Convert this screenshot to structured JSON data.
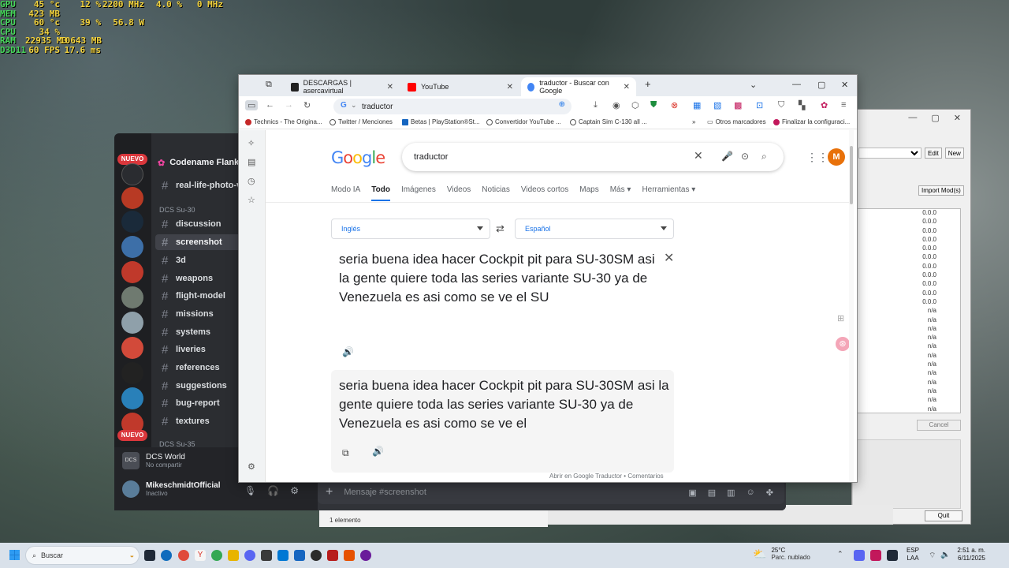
{
  "osd": [
    {
      "label": "GPU",
      "values": [
        "45 °c",
        "12 %",
        "2200 MHz",
        "4.0 %",
        "0 MHz"
      ]
    },
    {
      "label": "MEM",
      "values": [
        "423 MB",
        "",
        "",
        "",
        ""
      ]
    },
    {
      "label": "CPU",
      "values": [
        "60 °c",
        "39 %",
        "56.8 W",
        "",
        ""
      ]
    },
    {
      "label": "CPU",
      "values": [
        "34 %",
        "",
        "",
        "",
        ""
      ]
    },
    {
      "label": "RAM",
      "values": [
        "22935 MB",
        "10643 MB",
        "",
        "",
        ""
      ]
    },
    {
      "label": "D3D11",
      "values": [
        "60 FPS",
        "17.6 ms",
        "",
        "",
        ""
      ]
    }
  ],
  "right_app": {
    "buttons": [
      "Edit",
      "New"
    ],
    "import_label": "Import Mod(s)",
    "rows": [
      "0.0.0",
      "0.0.0",
      "0.0.0",
      "0.0.0",
      "0.0.0",
      "0.0.0",
      "0.0.0",
      "0.0.0",
      "0.0.0",
      "0.0.0",
      "0.0.0",
      "n/a",
      "n/a",
      "n/a",
      "n/a",
      "n/a",
      "n/a",
      "n/a",
      "n/a",
      "n/a",
      "n/a",
      "n/a",
      "n/a"
    ],
    "cancel": "Cancel",
    "quit": "Quit"
  },
  "explorer": {
    "status": "1 elemento"
  },
  "discord": {
    "badge_new": "NUEVO",
    "server_name": "Codename Flanker",
    "categories": [
      "DCS Su-30",
      "DCS Su-35"
    ],
    "channels": [
      "real-life-photo-vi",
      "discussion",
      "screenshot",
      "3d",
      "weapons",
      "flight-model",
      "missions",
      "systems",
      "liveries",
      "references",
      "suggestions",
      "bug-report",
      "textures"
    ],
    "voice_title": "DCS World",
    "voice_sub": "No compartir",
    "username": "MikeschmidtOfficial",
    "user_status": "Inactivo",
    "message_placeholder": "Mensaje #screenshot"
  },
  "chrome": {
    "tabs": [
      {
        "title": "DESCARGAS | asercavirtual",
        "color": "#1a1a1a"
      },
      {
        "title": "YouTube",
        "color": "#ff0000"
      },
      {
        "title": "traductor - Buscar con Google",
        "color": "#4285f4"
      }
    ],
    "omnibox": "traductor",
    "bookmarks": [
      "Technics - The Origina...",
      "Twitter / Menciones",
      "Betas | PlayStation®St...",
      "Convertidor YouTube ...",
      "Captain Sim C-130 all ..."
    ],
    "other_bookmarks": "Otros marcadores",
    "finish_config": "Finalizar la configuraci..."
  },
  "google": {
    "logo": "Google",
    "query": "traductor",
    "avatar_letter": "M",
    "tabs": [
      "Modo IA",
      "Todo",
      "Imágenes",
      "Videos",
      "Noticias",
      "Videos cortos",
      "Maps",
      "Más",
      "Herramientas"
    ],
    "source_lang": "Inglés",
    "target_lang": "Español",
    "source_text": "seria buena idea hacer Cockpit pit para SU-30SM asi la gente quiere toda las series variante SU-30 ya de Venezuela es asi como se ve el SU",
    "translated_text": "seria buena idea hacer Cockpit pit para SU-30SM asi la gente quiere toda las series variante SU-30 ya de Venezuela es asi como se ve el",
    "footer_link": "Abrir en Google Traductor",
    "footer_sep": "•",
    "footer_comments": "Comentarios"
  },
  "taskbar": {
    "search": "Buscar",
    "weather_temp": "25°C",
    "weather_desc": "Parc. nublado",
    "lang_top": "ESP",
    "lang_bottom": "LAA",
    "time": "2:51 a. m.",
    "date": "6/11/2025"
  }
}
